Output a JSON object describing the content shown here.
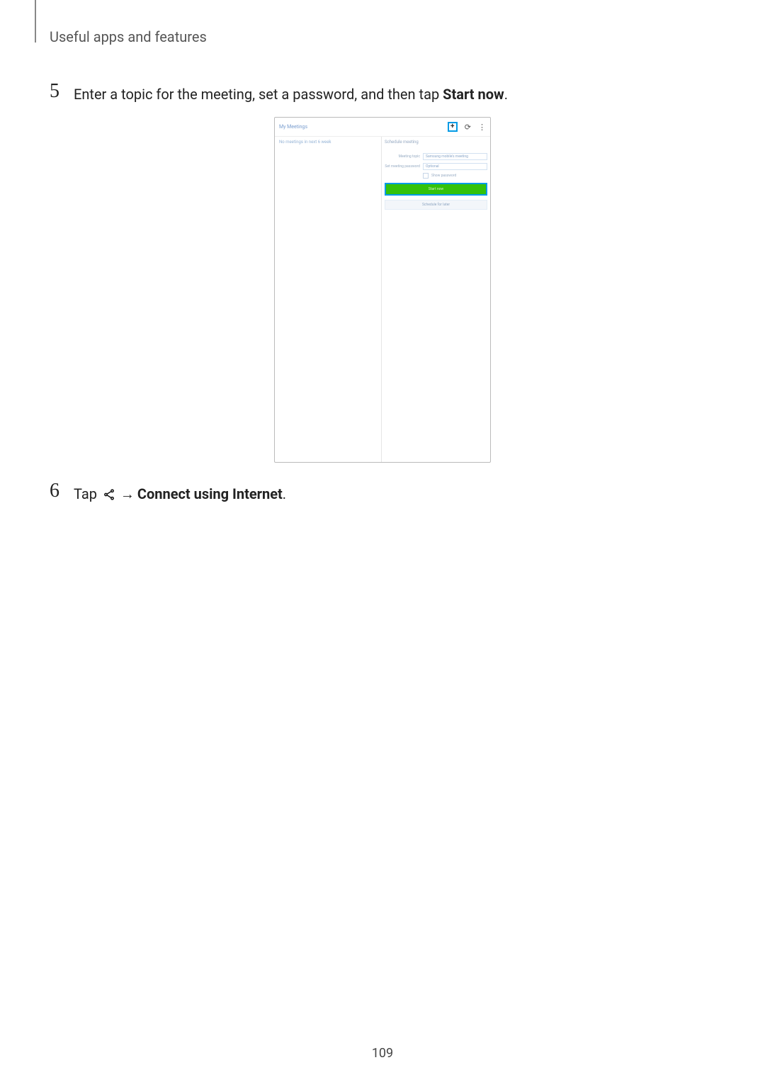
{
  "header": {
    "section_title": "Useful apps and features"
  },
  "steps": {
    "s5": {
      "number": "5",
      "pre": "Enter a topic for the meeting, set a password, and then tap ",
      "bold": "Start now",
      "post": "."
    },
    "s6": {
      "number": "6",
      "pre": "Tap ",
      "arrow": "→",
      "bold": "Connect using Internet",
      "post": "."
    }
  },
  "figure": {
    "app_title": "My Meetings",
    "plus": "+",
    "refresh": "⟳",
    "more": "⋮",
    "left_text": "No meetings in next 6 week",
    "sched_title": "Schedule meeting",
    "topic_label": "Meeting topic",
    "topic_value": "Samsung mobile's meeting",
    "password_label": "Set meeting password",
    "password_placeholder": "Optional",
    "show_pw_label": "Show password",
    "start_btn": "Start now",
    "later_btn": "Schedule for later"
  },
  "page_number": "109"
}
